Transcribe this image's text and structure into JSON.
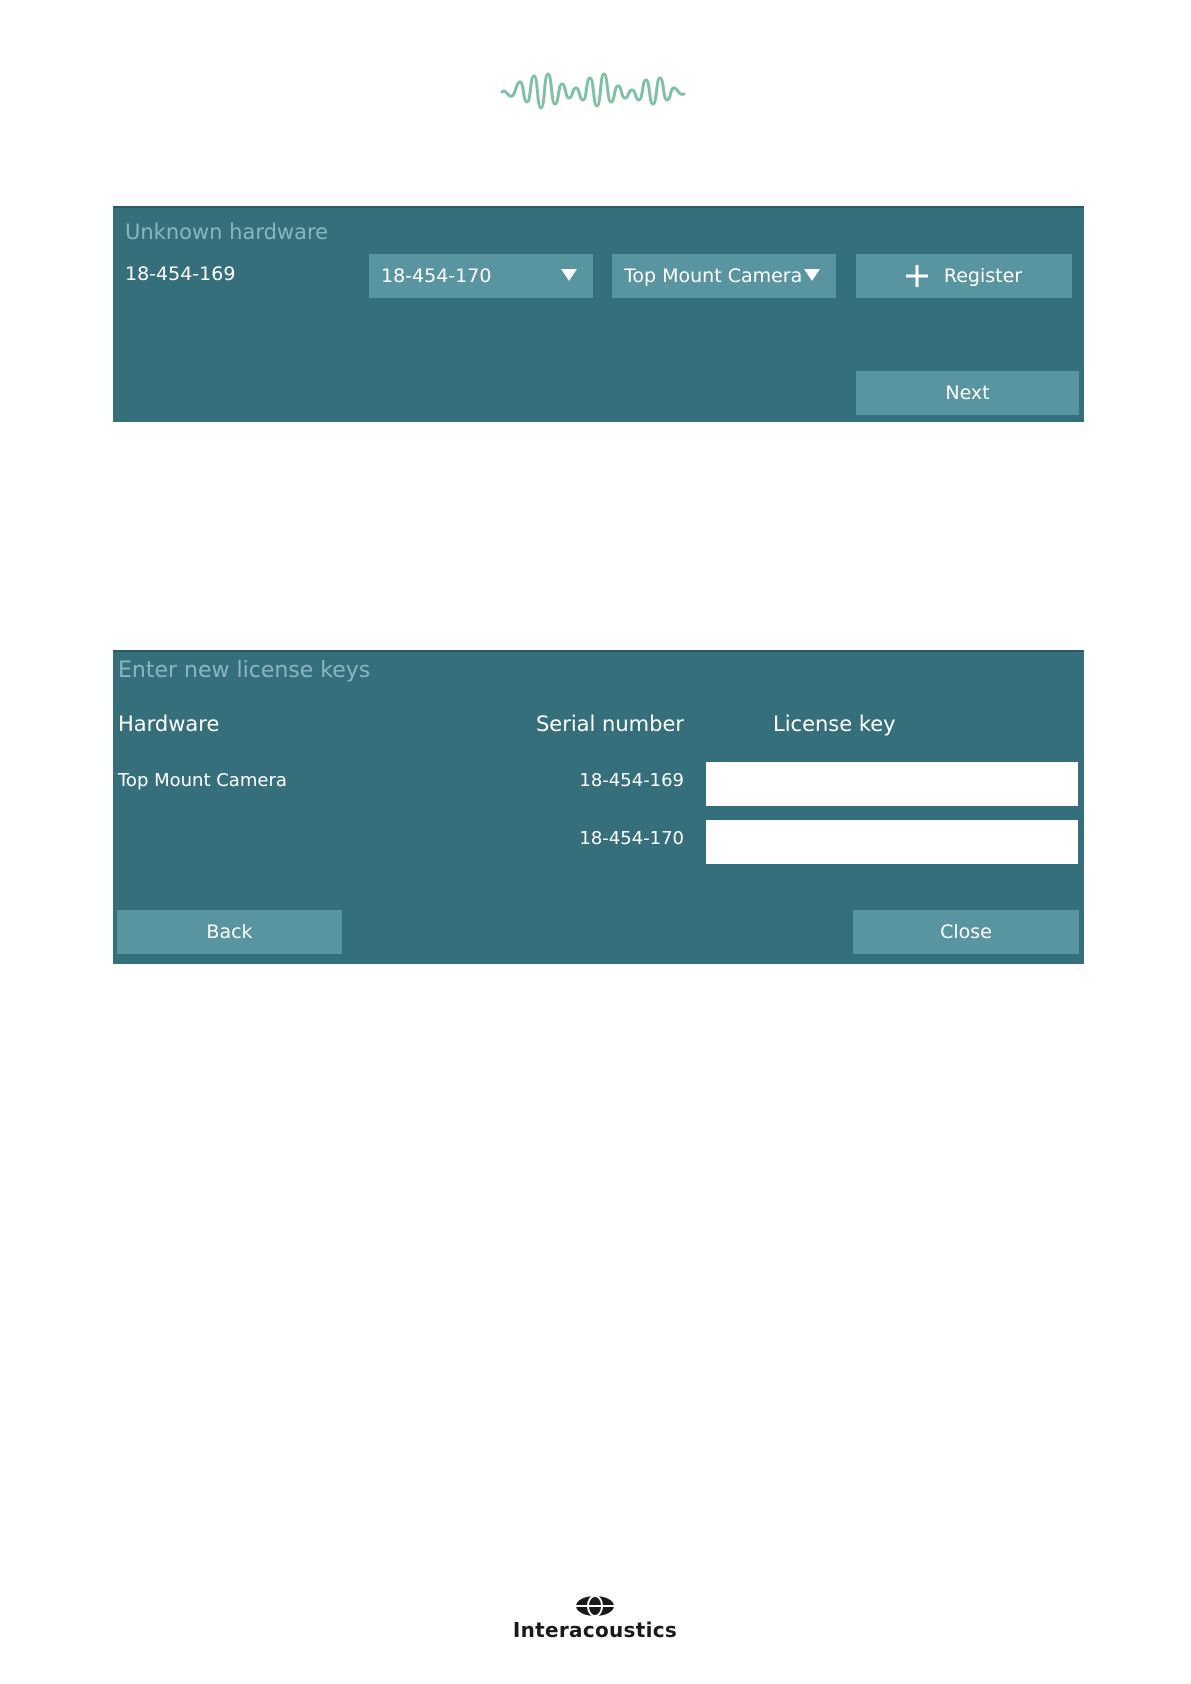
{
  "brand": {
    "name": "Interacoustics",
    "wave_color": "#7fbfa4"
  },
  "unknown_hardware": {
    "title": "Unknown hardware",
    "serial_label": "18-454-169",
    "serial_dropdown_value": "18-454-170",
    "hardware_dropdown_value": "Top Mount Camera",
    "register_label": "Register",
    "next_label": "Next"
  },
  "license_keys": {
    "title": "Enter new license keys",
    "columns": {
      "hardware": "Hardware",
      "serial": "Serial number",
      "license": "License key"
    },
    "rows": [
      {
        "hardware": "Top Mount Camera",
        "serial": "18-454-169",
        "license_key": ""
      },
      {
        "hardware": "",
        "serial": "18-454-170",
        "license_key": ""
      }
    ],
    "back_label": "Back",
    "close_label": "Close"
  },
  "colors": {
    "panel_bg": "#366f7c",
    "button_bg": "#5994a1",
    "title_text": "#8ab5bf",
    "text": "#ffffff"
  }
}
